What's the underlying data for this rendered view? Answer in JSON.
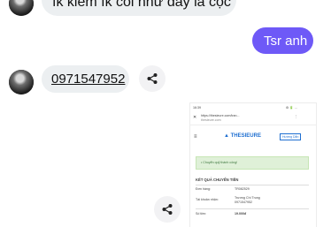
{
  "messages": [
    {
      "text": "ík kiếm ík coi như đây là cọc"
    },
    {
      "text": "Tsr anh"
    },
    {
      "text": "0971547952"
    }
  ],
  "screenshot": {
    "status_time": "16:39",
    "status_right": "⚙ 🔋 ...",
    "url": "https://thesieure.com/tran...",
    "url_sub": "thesieure.com",
    "brand": "THESIEURE",
    "brand_button": "Hướng Dẫn",
    "success": "• Chuyển quỹ thành công!",
    "section_title": "KẾT QUẢ CHUYỂN TIỀN",
    "rows": [
      {
        "label": "Đơn hàng:",
        "value": "TR082529"
      },
      {
        "label": "Tài khoản nhận:",
        "value": "Trương Chí Trung\n0971547952"
      },
      {
        "label": "Số tiền:",
        "value": "19.000đ"
      }
    ]
  },
  "colors": {
    "accent": "#6e59f7",
    "bubble_in": "#eceff1",
    "brand": "#1f6fd1",
    "success_bg": "#dff0d8"
  }
}
